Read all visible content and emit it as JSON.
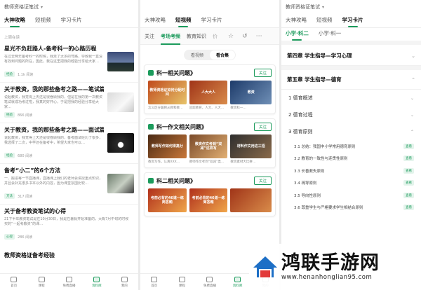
{
  "panel1": {
    "app_title": "教师资格证笔试",
    "tabs": [
      "大神攻略",
      "短视频",
      "学习卡片"
    ],
    "section_label": "上周在读",
    "articles": [
      {
        "title": "星光不负赶路人-备考科一的心路历程",
        "summary": "在过去两年备考科一的时候，我走了太多的弯路，导致我一直没有找到问题的所在，因此，我在这里把我的经验分享给大家…",
        "badge": "经验",
        "views": "1.1k 阅读",
        "thumb": "night-landscape"
      },
      {
        "title": "关于教资，我的那些备考之路——笔试篇",
        "summary": "说起教资，我觉得上天还是很眷顾我的，但是在我的第一次教资笔试就成功考过啦，我真的好开心，于是把我的经验分享给大家…",
        "badge": "经验",
        "views": "866 阅读",
        "thumb": "pen-on-paper"
      },
      {
        "title": "关于教资，我的那些备考之路——面试篇",
        "summary": "说起教资，我觉得上天还是很眷顾我的，备考面试经历了很多，我选择了二次，中学还在备考中，希望大家也可以…",
        "badge": "经验",
        "views": "680 阅读",
        "thumb": "desk-lamp"
      },
      {
        "title": "备考“小二”的6个方法",
        "summary": "一、搬进每一节直播课，直播课上我们的老师会讲授重点知识，并且会补充很多书本以外的内容，因为课堂氛围比较…",
        "badge": "方法",
        "views": "317 阅读",
        "thumb": "stationery"
      },
      {
        "title": "关于备考教资笔试的心得",
        "summary": "21下半年教资笔试是在10月30日，我是在暑假开始准备的，大概7月中旬的时候买的“一起考教资”的课…",
        "badge": "心得",
        "views": "286 阅读",
        "thumb": "books"
      }
    ],
    "last_title": "教师资格证备考经验",
    "nav": [
      "首页",
      "课程",
      "免费直播",
      "资料库",
      "我的"
    ]
  },
  "panel2": {
    "tabs": [
      "大神攻略",
      "短视频",
      "学习卡片"
    ],
    "subtabs": [
      "关注",
      "考场考频",
      "教育知识",
      "价"
    ],
    "segments": [
      "看视频",
      "看合集"
    ],
    "cards": [
      {
        "title": "科一相关问题》",
        "follow": "关注",
        "videos": [
          {
            "thumb_text": "教师资格证如何分配时间",
            "caption": "怎么区分兼顾从教和教…"
          },
          {
            "thumb_text": "人大大人",
            "caption": "追踪教育，人大、人大…"
          },
          {
            "thumb_text": "教资",
            "caption": "教资科一…"
          }
        ]
      },
      {
        "title": "科一作文相关问题》",
        "follow": "关注",
        "videos": [
          {
            "thumb_text": "教师写作如何得高分",
            "caption": "教资写作，认真XXX…"
          },
          {
            "thumb_text": "教资作文考到“双减”这样写",
            "caption": "教师作文考到“双减”类…"
          },
          {
            "thumb_text": "材料作文用这三招",
            "caption": "教资素材大比拼…"
          }
        ]
      },
      {
        "title": "科二相关问题》",
        "follow": "关注",
        "videos": [
          {
            "thumb_text": "考前必背的46道一练简答题",
            "caption": ""
          },
          {
            "thumb_text": "考前必背的46道一练简答题",
            "caption": ""
          },
          {
            "thumb_text": "",
            "caption": ""
          }
        ]
      }
    ],
    "nav": [
      "首页",
      "课程",
      "免费直播",
      "资料库",
      "我的"
    ]
  },
  "panel3": {
    "app_title": "教师资格证笔试",
    "tabs": [
      "大神攻略",
      "短视频",
      "学习卡片"
    ],
    "subtabs": [
      "小学·科二",
      "小学·科一"
    ],
    "chapters": [
      {
        "title": "第四章 学生指导—学习心理",
        "chevron": "⌄"
      },
      {
        "title": "第五章 学生指导—德育",
        "chevron": "⌃"
      }
    ],
    "sections": [
      {
        "title": "1 德育概述",
        "chevron": "⌄"
      },
      {
        "title": "2 德育过程",
        "chevron": "⌄"
      },
      {
        "title": "3 德育原则",
        "chevron": "⌃"
      }
    ],
    "items": [
      {
        "title": "3.1 总结：我国中小学常用德育原则",
        "badge": "查看"
      },
      {
        "title": "3.2 教育的一致性与连贯性原则",
        "badge": "查看"
      },
      {
        "title": "3.3 长善救失原则",
        "badge": "查看"
      },
      {
        "title": "3.4 疏导原则",
        "badge": "查看"
      },
      {
        "title": "3.5 导向性原则",
        "badge": "查看"
      },
      {
        "title": "3.6 尊重学生与严格要求学生相结合原则",
        "badge": "查看"
      }
    ]
  },
  "watermark": {
    "name": "鸿联手游网",
    "url": "www.henanhonglian95.com"
  },
  "colors": {
    "accent": "#1c9b5c",
    "badge_bg": "#e4f4ec"
  }
}
